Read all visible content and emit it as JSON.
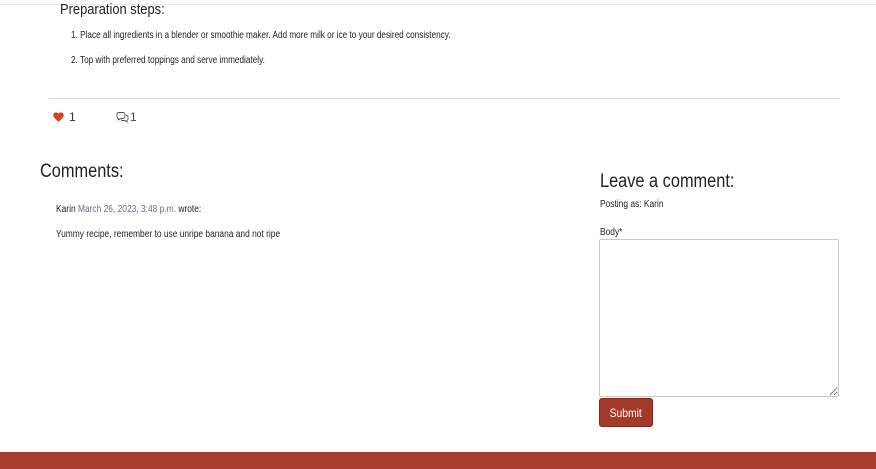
{
  "colors": {
    "accent": "#a53c2c",
    "heart": "#d9401e",
    "date_text": "#6a6f8a"
  },
  "recipe": {
    "preparation_title": "Preparation steps:",
    "steps": [
      "1. Place all ingredients in a blender or smoothie maker. Add more milk or ice to your desired consistency.",
      "2. Top with preferred toppings and serve immediately."
    ]
  },
  "stats": {
    "like_icon": "heart-icon",
    "like_count": "1",
    "comment_icon": "comment-bubbles-icon",
    "comment_count": "1"
  },
  "comments": {
    "heading": "Comments:",
    "items": [
      {
        "author": "Karin",
        "date": "March 26, 2023, 3:48 p.m.",
        "wrote": "wrote:",
        "body": "Yummy recipe, remember to use unripe banana and not ripe"
      }
    ]
  },
  "comment_form": {
    "heading": "Leave a comment:",
    "posting_as": "Posting as: Karin",
    "body_label": "Body*",
    "body_value": "",
    "submit_label": "Submit"
  }
}
